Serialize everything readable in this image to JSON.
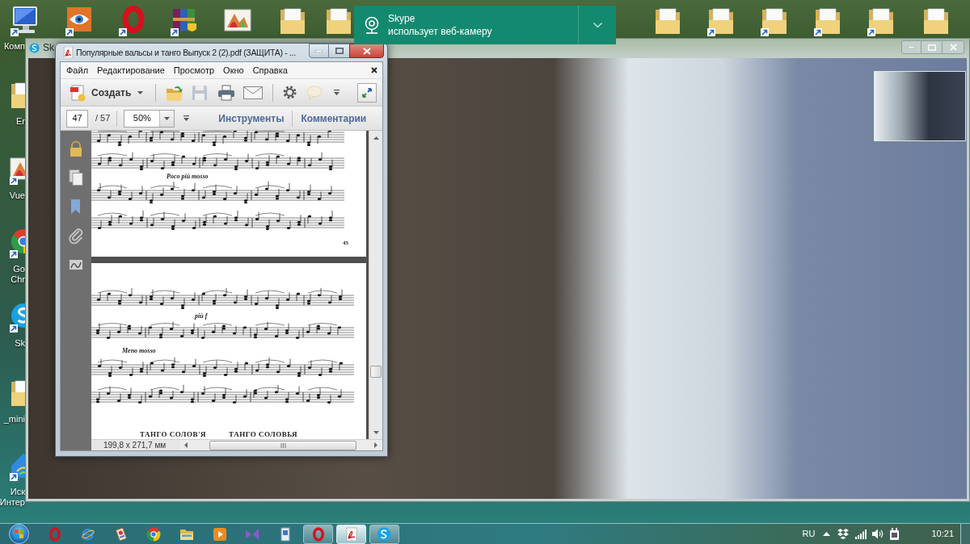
{
  "desktop": {
    "shortcuts": [
      {
        "kind": "computer",
        "label": [
          "Комп"
        ]
      },
      {
        "kind": "folder",
        "label": [
          "Er"
        ]
      },
      {
        "kind": "picture",
        "label": [
          "Vue"
        ]
      },
      {
        "kind": "chrome",
        "label": [
          "Go",
          "Chr"
        ]
      },
      {
        "kind": "skype",
        "label": [
          "Sk"
        ]
      },
      {
        "kind": "folder",
        "label": [
          "_mini"
        ]
      },
      {
        "kind": "network",
        "label": [
          "Иск",
          "Интер"
        ]
      }
    ]
  },
  "notification": {
    "app": "Skype",
    "message": "использует веб-камеру"
  },
  "skype_window": {
    "title": "Sk"
  },
  "pdf_window": {
    "title": "Популярные вальсы и танго Выпуск 2 (2).pdf (ЗАЩИТА) - ...",
    "menu": [
      "Файл",
      "Редактирование",
      "Просмотр",
      "Окно",
      "Справка"
    ],
    "toolbar": [
      {
        "kind": "create",
        "label": "Создать"
      },
      {
        "kind": "open",
        "disabled": false
      },
      {
        "kind": "save",
        "disabled": true
      },
      {
        "kind": "print",
        "disabled": false
      },
      {
        "kind": "email",
        "disabled": false
      },
      {
        "kind": "settings",
        "disabled": false
      },
      {
        "kind": "comment",
        "disabled": true
      }
    ],
    "page": "47",
    "page_count": "/ 57",
    "zoom": "50%",
    "panes": [
      "Инструменты",
      "Комментарии"
    ],
    "document": {
      "pages": [
        {
          "tempo_marking": "Poco più mosso",
          "page_number": "45"
        },
        {
          "dynamic": "più f",
          "tempo_marking": "Meno mosso",
          "titles": [
            "ТАНГО СОЛОВ'Я",
            "ТАНГО СОЛОВЬЯ"
          ]
        }
      ]
    },
    "page_size": "199,8 x 271,7 мм"
  },
  "taskbar": {
    "items": [
      {
        "kind": "opera",
        "running": false,
        "selected": false
      },
      {
        "kind": "ie",
        "running": false,
        "selected": false
      },
      {
        "kind": "tool",
        "running": false,
        "selected": false
      },
      {
        "kind": "chrome",
        "running": false,
        "selected": false
      },
      {
        "kind": "explorer",
        "running": false,
        "selected": false
      },
      {
        "kind": "media",
        "running": false,
        "selected": false
      },
      {
        "kind": "vs",
        "running": false,
        "selected": false
      },
      {
        "kind": "file",
        "running": false,
        "selected": false
      },
      {
        "kind": "opera",
        "running": true,
        "selected": false
      },
      {
        "kind": "pdf",
        "running": true,
        "selected": true
      },
      {
        "kind": "skype",
        "running": true,
        "selected": false
      }
    ],
    "language": "RU",
    "time": "10:21"
  }
}
